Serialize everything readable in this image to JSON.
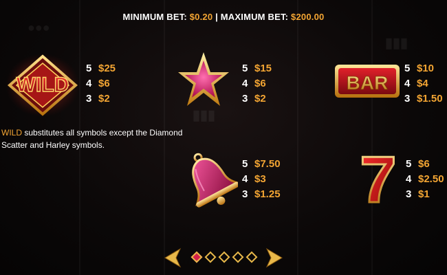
{
  "header": {
    "min_label": "MINIMUM BET: ",
    "min_value": "$0.20",
    "separator": " | ",
    "max_label": "MAXIMUM BET: ",
    "max_value": "$200.00"
  },
  "symbols": {
    "wild": {
      "label": "WILD",
      "icon": "wild-diamond-icon",
      "pays": [
        {
          "count": "5",
          "amount": "$25"
        },
        {
          "count": "4",
          "amount": "$6"
        },
        {
          "count": "3",
          "amount": "$2"
        }
      ]
    },
    "star": {
      "icon": "star-icon",
      "pays": [
        {
          "count": "5",
          "amount": "$15"
        },
        {
          "count": "4",
          "amount": "$6"
        },
        {
          "count": "3",
          "amount": "$2"
        }
      ]
    },
    "bar": {
      "label": "BAR",
      "icon": "bar-icon",
      "pays": [
        {
          "count": "5",
          "amount": "$10"
        },
        {
          "count": "4",
          "amount": "$4"
        },
        {
          "count": "3",
          "amount": "$1.50"
        }
      ]
    },
    "bell": {
      "icon": "bell-icon",
      "pays": [
        {
          "count": "5",
          "amount": "$7.50"
        },
        {
          "count": "4",
          "amount": "$3"
        },
        {
          "count": "3",
          "amount": "$1.25"
        }
      ]
    },
    "seven": {
      "label": "7",
      "icon": "seven-icon",
      "pays": [
        {
          "count": "5",
          "amount": "$6"
        },
        {
          "count": "4",
          "amount": "$2.50"
        },
        {
          "count": "3",
          "amount": "$1"
        }
      ]
    }
  },
  "wild_description": {
    "highlight": "WILD",
    "text": " substitutes all symbols except the Diamond Scatter and Harley symbols."
  },
  "pagination": {
    "total_pages": 5,
    "current_page": 1
  },
  "colors": {
    "accent": "#f3a533",
    "text": "#ffffff",
    "gold": "#e8b84a",
    "red": "#d4224a"
  }
}
